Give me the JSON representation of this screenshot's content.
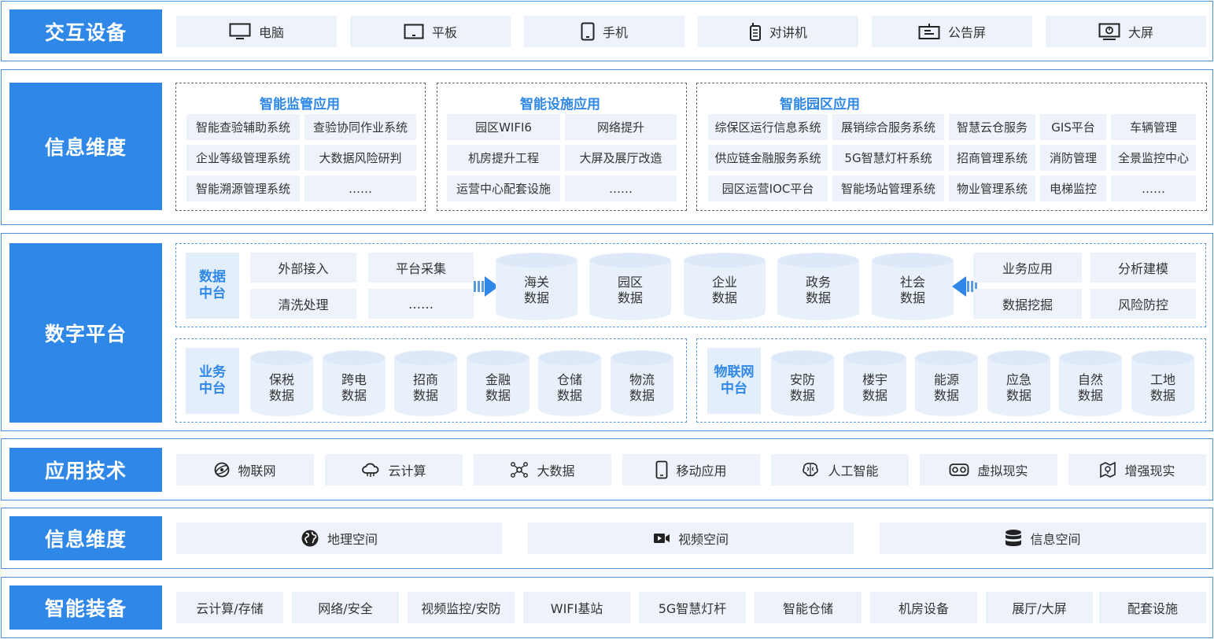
{
  "rows": {
    "devices": {
      "label": "交互设备",
      "items": [
        {
          "label": "电脑",
          "icon": "monitor-icon"
        },
        {
          "label": "平板",
          "icon": "tablet-icon"
        },
        {
          "label": "手机",
          "icon": "phone-icon"
        },
        {
          "label": "对讲机",
          "icon": "walkie-talkie-icon"
        },
        {
          "label": "公告屏",
          "icon": "notice-screen-icon"
        },
        {
          "label": "大屏",
          "icon": "big-screen-icon"
        }
      ]
    },
    "info": {
      "label": "信息维度",
      "groups": [
        {
          "title": "智能监管应用",
          "items": [
            "智能查验辅助系统",
            "查验协同作业系统",
            "企业等级管理系统",
            "大数据风险研判",
            "智能溯源管理系统",
            "……"
          ]
        },
        {
          "title": "智能设施应用",
          "items": [
            "园区WIFI6",
            "网络提升",
            "机房提升工程",
            "大屏及展厅改造",
            "运营中心配套设施",
            "……"
          ]
        },
        {
          "title": "智能园区应用",
          "items": [
            "综保区运行信息系统",
            "展销综合服务系统",
            "智慧云仓服务",
            "GIS平台",
            "车辆管理",
            "供应链金融服务系统",
            "5G智慧灯杆系统",
            "招商管理系统",
            "消防管理",
            "全景监控中心",
            "园区运营IOC平台",
            "智能场站管理系统",
            "物业管理系统",
            "电梯监控",
            "……"
          ]
        }
      ]
    },
    "platform": {
      "label": "数字平台",
      "data_center": {
        "tag": [
          "数据",
          "中台"
        ],
        "left_items": [
          "外部接入",
          "平台采集",
          "清洗处理",
          "……"
        ],
        "cylinders": [
          [
            "海关",
            "数据"
          ],
          [
            "园区",
            "数据"
          ],
          [
            "企业",
            "数据"
          ],
          [
            "政务",
            "数据"
          ],
          [
            "社会",
            "数据"
          ]
        ],
        "right_items": [
          "业务应用",
          "分析建模",
          "数据挖掘",
          "风险防控"
        ]
      },
      "business_center": {
        "tag": [
          "业务",
          "中台"
        ],
        "cylinders": [
          [
            "保税",
            "数据"
          ],
          [
            "跨电",
            "数据"
          ],
          [
            "招商",
            "数据"
          ],
          [
            "金融",
            "数据"
          ],
          [
            "仓储",
            "数据"
          ],
          [
            "物流",
            "数据"
          ]
        ]
      },
      "iot_center": {
        "tag": [
          "物联网",
          "中台"
        ],
        "cylinders": [
          [
            "安防",
            "数据"
          ],
          [
            "楼宇",
            "数据"
          ],
          [
            "能源",
            "数据"
          ],
          [
            "应急",
            "数据"
          ],
          [
            "自然",
            "数据"
          ],
          [
            "工地",
            "数据"
          ]
        ]
      }
    },
    "tech": {
      "label": "应用技术",
      "items": [
        {
          "label": "物联网",
          "icon": "iot-globe-icon"
        },
        {
          "label": "云计算",
          "icon": "cloud-icon"
        },
        {
          "label": "大数据",
          "icon": "network-nodes-icon"
        },
        {
          "label": "移动应用",
          "icon": "mobile-app-icon"
        },
        {
          "label": "人工智能",
          "icon": "brain-icon"
        },
        {
          "label": "虚拟现实",
          "icon": "vr-headset-icon"
        },
        {
          "label": "增强现实",
          "icon": "ar-map-icon"
        }
      ]
    },
    "space": {
      "label": "信息维度",
      "items": [
        {
          "label": "地理空间",
          "icon": "globe-icon"
        },
        {
          "label": "视频空间",
          "icon": "video-camera-icon"
        },
        {
          "label": "信息空间",
          "icon": "database-icon"
        }
      ]
    },
    "equipment": {
      "label": "智能装备",
      "items": [
        "云计算/存储",
        "网络/安全",
        "视频监控/安防",
        "WIFI基站",
        "5G智慧灯杆",
        "智能仓储",
        "机房设备",
        "展厅/大屏",
        "配套设施"
      ]
    }
  },
  "colors": {
    "accent": "#2f88e8",
    "cell_bg": "#eef3fb",
    "border": "#4a90e2"
  }
}
